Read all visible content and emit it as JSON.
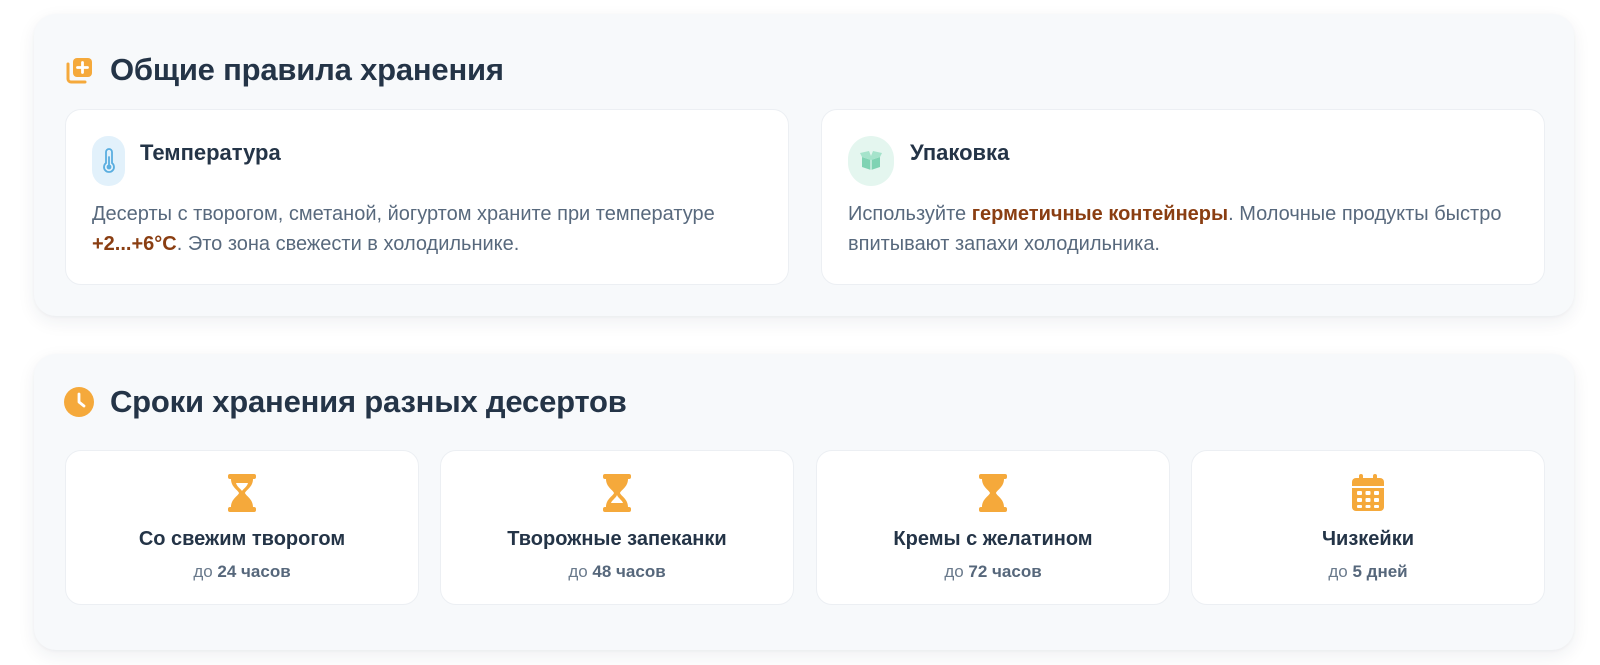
{
  "colors": {
    "accent": "#f5a93b",
    "highlight": "#8a3e12",
    "title": "#243447",
    "body_text": "#58697d"
  },
  "rules_section": {
    "title": "Общие правила хранения",
    "icon": "copy-plus-icon",
    "cards": [
      {
        "title": "Температура",
        "icon": "thermometer-icon",
        "text_before": "Десерты с творогом, сметаной, йогуртом храните при температуре ",
        "highlight": "+2...+6°C",
        "text_after": ". Это зона свежести в холодильнике."
      },
      {
        "title": "Упаковка",
        "icon": "box-icon",
        "text_before": "Используйте ",
        "highlight": "герметичные контейнеры",
        "text_after": ". Молочные продукты быстро впитывают запахи холодильника."
      }
    ]
  },
  "terms_section": {
    "title": "Сроки хранения разных десертов",
    "icon": "clock-icon",
    "items": [
      {
        "title": "Со свежим творогом",
        "prefix": "до",
        "value": "24 часов",
        "icon": "hourglass-icon"
      },
      {
        "title": "Творожные запеканки",
        "prefix": "до",
        "value": "48 часов",
        "icon": "hourglass-icon"
      },
      {
        "title": "Кремы с желатином",
        "prefix": "до",
        "value": "72 часов",
        "icon": "hourglass-icon"
      },
      {
        "title": "Чизкейки",
        "prefix": "до",
        "value": "5 дней",
        "icon": "calendar-icon"
      }
    ]
  }
}
